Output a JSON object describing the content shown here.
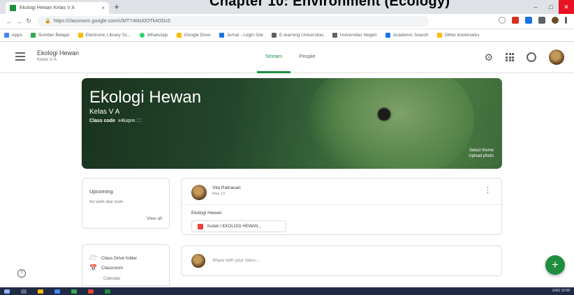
{
  "overlay_title": "Chapter 10: Environment (Ecology)",
  "browser": {
    "tab_title": "Ekologi Hewan Kelas V A",
    "tab_close": "×",
    "new_tab": "+",
    "url": "https://classroom.google.com/c/MTY4MzI0OTk4ODc5",
    "bookmarks": [
      {
        "label": "Apps",
        "color": "#4285f4"
      },
      {
        "label": "Sumber Belajar",
        "color": "#34a853"
      },
      {
        "label": "Electronic Library Sc...",
        "color": "#fbbc04"
      },
      {
        "label": "WhatsApp",
        "color": "#25d366"
      },
      {
        "label": "Google Drive",
        "color": "#fbbc04"
      },
      {
        "label": "Jurnal - Login Site",
        "color": "#1a73e8"
      },
      {
        "label": "E-learning Universitas",
        "color": "#5f6368"
      },
      {
        "label": "Universitas Negeri",
        "color": "#5f6368"
      },
      {
        "label": "Academic Search",
        "color": "#1a73e8"
      },
      {
        "label": "Other bookmarks",
        "color": "#fbbc04"
      }
    ]
  },
  "header": {
    "class_title": "Ekologi Hewan",
    "class_subtitle": "Kelas V A",
    "tabs": [
      "Stream",
      "People"
    ],
    "active_tab": "Stream"
  },
  "banner": {
    "title": "Ekologi Hewan",
    "subtitle": "Kelas V A",
    "class_code_label": "Class code",
    "class_code": "x4luqnn",
    "fullscreen_icon": "⛶",
    "select_theme": "Select theme",
    "upload_photo": "Upload photo"
  },
  "upcoming": {
    "title": "Upcoming",
    "text": "No work due soon",
    "view_all": "View all"
  },
  "links": {
    "drive_folder": "Class Drive folder",
    "calendar": "Classroom",
    "calendar2": "Calendar"
  },
  "post": {
    "author": "Vita Ratnasari",
    "date": "May 13",
    "text": "Ekologi Hewan",
    "attachment": "Kuliah I EKOLOGI HEWAN..."
  },
  "comment": {
    "placeholder": "Share with your class..."
  },
  "taskbar": {
    "tray": "ENG  10:58"
  },
  "colors": {
    "accent": "#1e8e3e",
    "banner": "#23452a"
  }
}
